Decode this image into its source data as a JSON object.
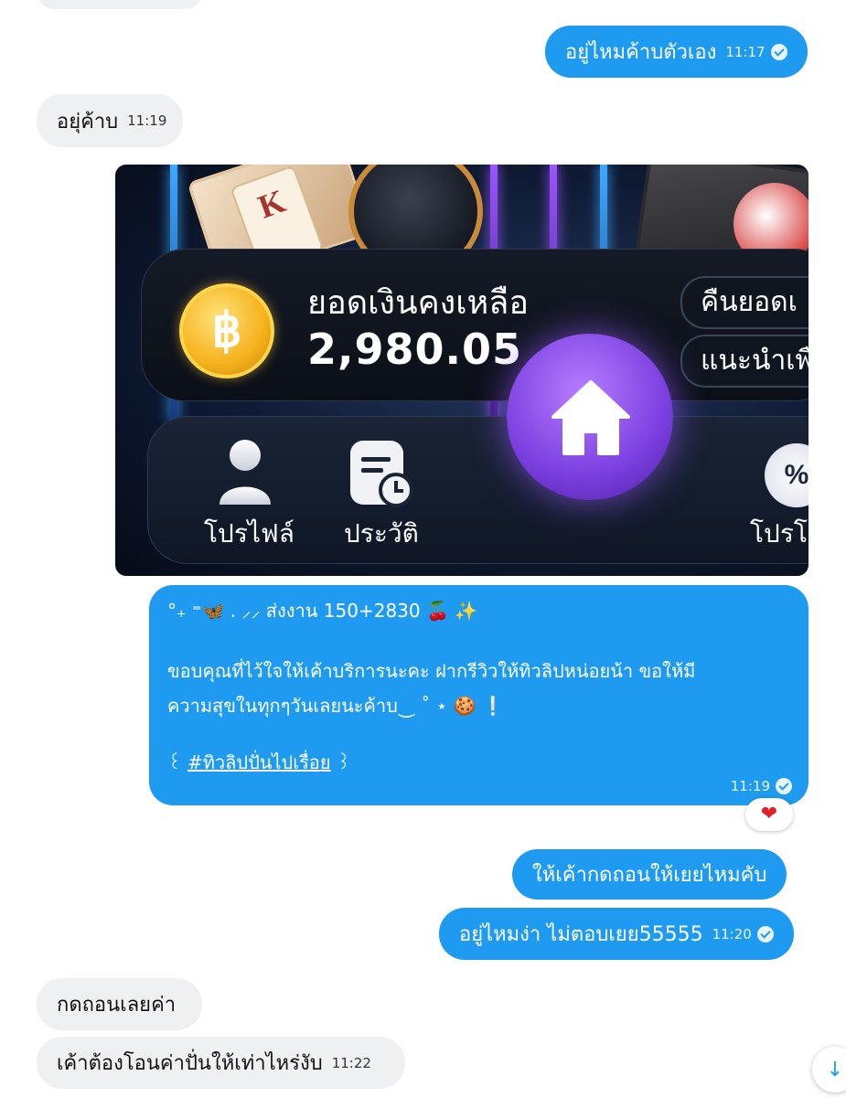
{
  "messages": {
    "m1": {
      "text": "อยู่ไหมค้าบตัวเอง",
      "time": "11:17"
    },
    "m2": {
      "text": "อยุ่ค้าบ",
      "time": "11:19"
    },
    "m3": {
      "line1": "°₊ ⁼🦋 . ⸝⸝ ส่งงาน 150+2830 🍒 ✨",
      "line2": "ขอบคุณที่ไว้ใจให้เค้าบริการนะคะ ฝากรีวิวให้ทิวลิปหน่อยน้า ขอให้มี",
      "line3": "ความสุขในทุกๆวันเลยนะค้าบ⏝ ˚ ⋆ 🍪 ❕",
      "tag_open": "꒰",
      "tag": "#ทิวลิปปั่นไปเรื่อย",
      "tag_close": "꒱",
      "time": "11:19",
      "reaction": "❤"
    },
    "m4": {
      "text": "ให้เค้ากดถอนให้เยยไหมคับ"
    },
    "m5": {
      "text": "อยู่ไหมง่า ไม่ตอบเยย55555",
      "time": "11:20"
    },
    "m6": {
      "text": "กดถอนเลยค่า"
    },
    "m7": {
      "text": "เค้าต้องโอนค่าปั่นให้เท่าไหร่งับ",
      "time": "11:22"
    }
  },
  "promo_image": {
    "balance_label": "ยอดเงินคงเหลือ",
    "balance_value": "2,980.05",
    "pill_1": "คืนยอดเ",
    "pill_2": "แนะนำเพื",
    "coin_symbol": "฿",
    "card_letter": "K",
    "nav_profile": "โปรไฟล์",
    "nav_history": "ประวัติ",
    "nav_promo": "โปรโม",
    "promo_symbol": "%"
  },
  "icons": {
    "read": "double-check-icon",
    "scroll": "arrow-down-icon"
  },
  "colors": {
    "outgoing_bubble": "#1e9bf0",
    "incoming_bubble": "#eef0f2",
    "home_button": "#7b3fe0",
    "coin": "#f5b21c"
  }
}
